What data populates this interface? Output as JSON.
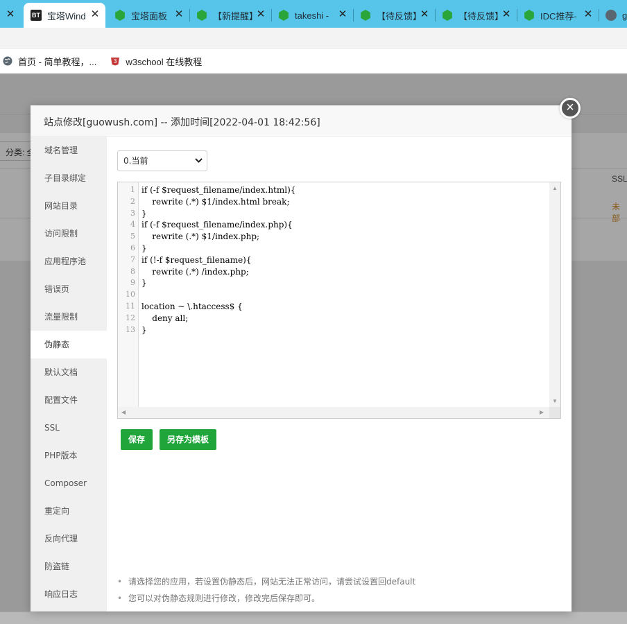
{
  "browser": {
    "tabs": [
      {
        "title": "",
        "favicon": "generic",
        "active": false
      },
      {
        "title": "宝塔Wind",
        "favicon": "bt-logo",
        "active": true
      },
      {
        "title": "宝塔面板",
        "favicon": "green-hex-icon",
        "active": false
      },
      {
        "title": "【新提醒】",
        "favicon": "green-hex-icon",
        "active": false
      },
      {
        "title": "takeshi -",
        "favicon": "green-hex-icon",
        "active": false
      },
      {
        "title": "【待反馈】",
        "favicon": "green-hex-icon",
        "active": false
      },
      {
        "title": "【待反馈】",
        "favicon": "green-hex-icon",
        "active": false
      },
      {
        "title": "IDC推荐-",
        "favicon": "green-hex-icon",
        "active": false
      },
      {
        "title": "gu",
        "favicon": "globe-icon",
        "active": false
      }
    ],
    "bt_favicon_text": "BT",
    "bookmarks": [
      {
        "label": "首页 - 简单教程，...",
        "icon": "globe-icon"
      },
      {
        "label": "w3school 在线教程",
        "icon": "w3school-icon"
      }
    ]
  },
  "background": {
    "filter_label": "分类: 全",
    "ssl_header": "SSL",
    "ssl_status": "未部",
    "status_color": "#8a5a1a"
  },
  "modal": {
    "title": "站点修改[guowush.com] -- 添加时间[2022-04-01 18:42:56]",
    "close_glyph": "×",
    "menu": [
      {
        "label": "域名管理",
        "active": false
      },
      {
        "label": "子目录绑定",
        "active": false
      },
      {
        "label": "网站目录",
        "active": false
      },
      {
        "label": "访问限制",
        "active": false
      },
      {
        "label": "应用程序池",
        "active": false
      },
      {
        "label": "错误页",
        "active": false
      },
      {
        "label": "流量限制",
        "active": false
      },
      {
        "label": "伪静态",
        "active": true
      },
      {
        "label": "默认文档",
        "active": false
      },
      {
        "label": "配置文件",
        "active": false
      },
      {
        "label": "SSL",
        "active": false
      },
      {
        "label": "PHP版本",
        "active": false
      },
      {
        "label": "Composer",
        "active": false
      },
      {
        "label": "重定向",
        "active": false
      },
      {
        "label": "反向代理",
        "active": false
      },
      {
        "label": "防盗链",
        "active": false
      },
      {
        "label": "响应日志",
        "active": false
      }
    ],
    "rewrite_select": {
      "value": "0.当前"
    },
    "editor": {
      "lines": [
        "if (-f $request_filename/index.html){",
        "    rewrite (.*) $1/index.html break;",
        "}",
        "if (-f $request_filename/index.php){",
        "    rewrite (.*) $1/index.php;",
        "}",
        "if (!-f $request_filename){",
        "    rewrite (.*) /index.php;",
        "}",
        "",
        "location ~ \\.htaccess$ {",
        "    deny all;",
        "}"
      ]
    },
    "buttons": {
      "save": "保存",
      "save_as_template": "另存为模板"
    },
    "tips": [
      "请选择您的应用，若设置伪静态后，网站无法正常访问，请尝试设置回default",
      "您可以对伪静态规则进行修改，修改完后保存即可。"
    ],
    "accent_color": "#20a53a"
  }
}
